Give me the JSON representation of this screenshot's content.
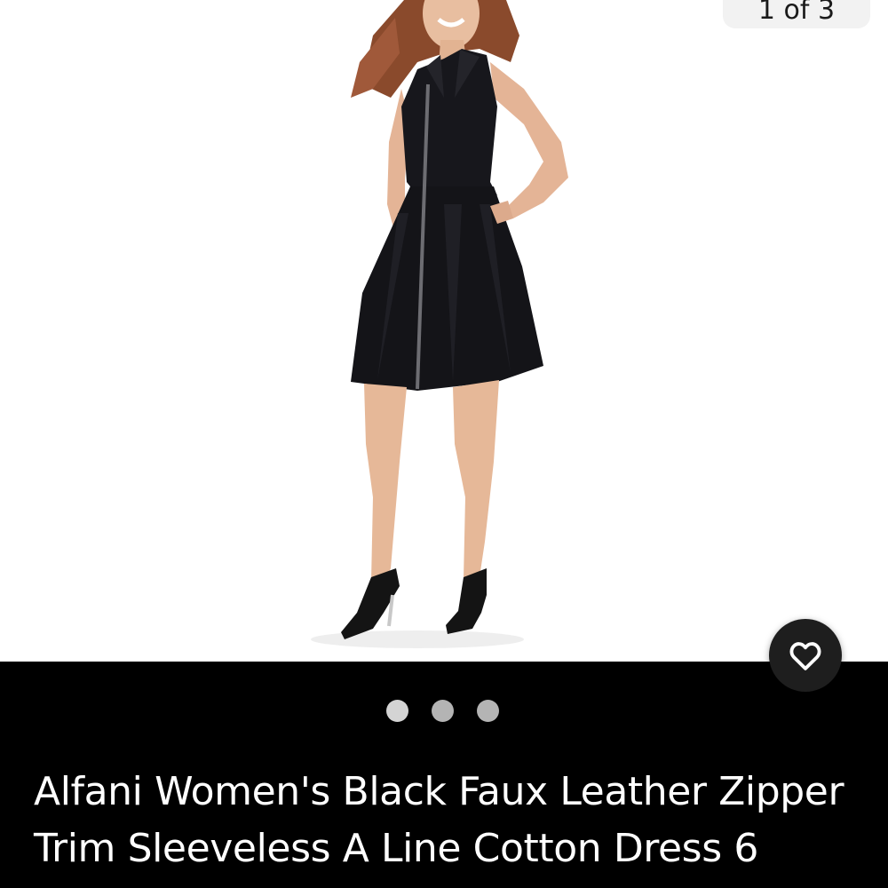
{
  "gallery": {
    "image_counter": "1 of 3",
    "image_alt": "Woman wearing a black sleeveless zip-front A-line dress with black heels",
    "pager": {
      "count": 3,
      "active_index": 0
    }
  },
  "actions": {
    "favorite_icon": "heart-outline-icon"
  },
  "listing": {
    "title": "Alfani Women's Black Faux Leather Zipper Trim Sleeveless A Line Cotton Dress 6"
  },
  "colors": {
    "background": "#000000",
    "photo_background": "#ffffff",
    "text": "#ffffff",
    "dot": "#b4b4b4",
    "favorite_button": "#1e1e1e"
  }
}
